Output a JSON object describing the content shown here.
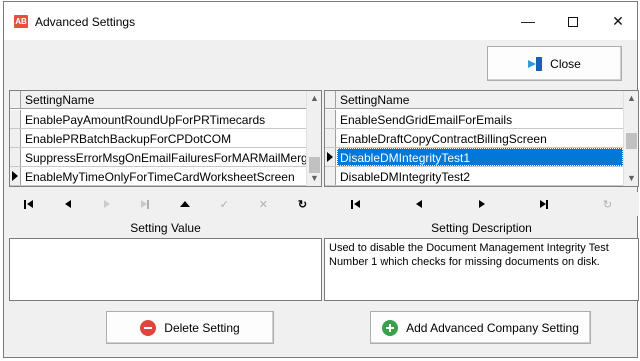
{
  "window": {
    "app_icon_text": "AB",
    "title": "Advanced Settings",
    "controls": {
      "minimize": "—",
      "close": "✕"
    }
  },
  "toolbar": {
    "close_label": "Close"
  },
  "left_grid": {
    "column": "SettingName",
    "rows": [
      "EnablePayAmountRoundUpForPRTimecards",
      "EnablePRBatchBackupForCPDotCOM",
      "SuppressErrorMsgOnEmailFailuresForMARMailMerg",
      "EnableMyTimeOnlyForTimeCardWorksheetScreen"
    ],
    "current_row_index": 3,
    "scroll_position": 0.75
  },
  "right_grid": {
    "column": "SettingName",
    "rows": [
      "EnableSendGridEmailForEmails",
      "EnableDraftCopyContractBillingScreen",
      "DisableDMIntegrityTest1",
      "DisableDMIntegrityTest2"
    ],
    "selected_row_index": 2,
    "scroll_position": 0.3
  },
  "left_nav": [
    "first",
    "prev",
    "next",
    "last",
    "insert",
    "post",
    "cancel",
    "refresh"
  ],
  "right_nav": [
    "first",
    "prev",
    "next",
    "last",
    "refresh"
  ],
  "labels": {
    "setting_value": "Setting Value",
    "setting_description": "Setting Description"
  },
  "setting_value": "",
  "setting_description": "Used to disable the Document Management Integrity Test Number 1 which checks for missing documents on disk.",
  "buttons": {
    "delete": "Delete Setting",
    "add": "Add Advanced Company Setting"
  },
  "colors": {
    "selection": "#0078d7",
    "delete_icon": "#e0443e",
    "add_icon": "#3aa14a",
    "app_icon": "#e0533f"
  }
}
